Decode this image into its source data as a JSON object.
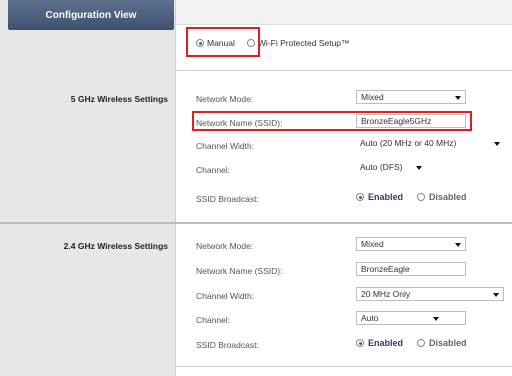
{
  "header": {
    "title": "Configuration View"
  },
  "mode": {
    "manual_label": "Manual",
    "wps_label": "Wi-Fi Protected Setup™",
    "selected": "manual"
  },
  "ghz5": {
    "title": "5 GHz Wireless Settings",
    "network_mode_label": "Network Mode:",
    "network_mode_value": "Mixed",
    "ssid_label": "Network Name (SSID):",
    "ssid_value": "BronzeEagle5GHz",
    "channel_width_label": "Channel Width:",
    "channel_width_value": "Auto (20 MHz or 40 MHz)",
    "channel_label": "Channel:",
    "channel_value": "Auto (DFS)",
    "ssid_broadcast_label": "SSID Broadcast:",
    "enabled_label": "Enabled",
    "disabled_label": "Disabled",
    "broadcast_selected": "enabled"
  },
  "ghz24": {
    "title": "2.4 GHz Wireless Settings",
    "network_mode_label": "Network Mode:",
    "network_mode_value": "Mixed",
    "ssid_label": "Network Name (SSID):",
    "ssid_value": "BronzeEagle",
    "channel_width_label": "Channel Width:",
    "channel_width_value": "20 MHz Only",
    "channel_label": "Channel:",
    "channel_value": "Auto",
    "ssid_broadcast_label": "SSID Broadcast:",
    "enabled_label": "Enabled",
    "disabled_label": "Disabled",
    "broadcast_selected": "enabled"
  },
  "colors": {
    "header_bg": "#4b5f7d",
    "highlight": "#e02020",
    "radio_selected": "#2a65b8"
  }
}
